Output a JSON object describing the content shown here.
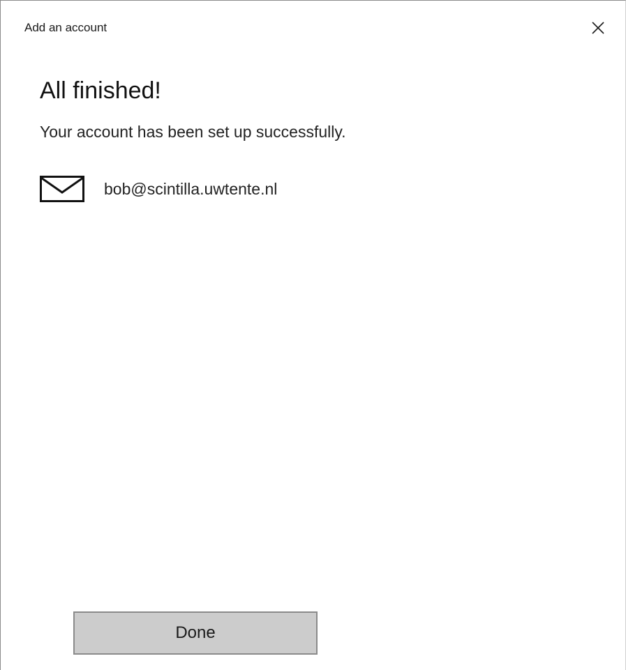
{
  "window": {
    "title": "Add an account",
    "close_icon": "close-icon"
  },
  "content": {
    "heading": "All finished!",
    "message": "Your account has been set up successfully.",
    "account": {
      "icon": "mail-icon",
      "email": "bob@scintilla.uwtente.nl"
    }
  },
  "footer": {
    "done_label": "Done"
  },
  "colors": {
    "button_bg": "#cccccc",
    "button_border": "#8a8a8a",
    "text": "#1a1a1a"
  }
}
